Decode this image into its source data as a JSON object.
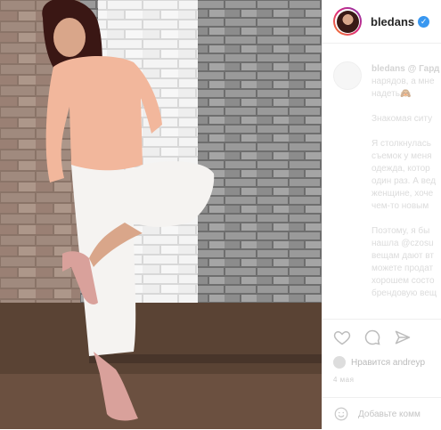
{
  "post": {
    "username": "bledans",
    "verified_mark": "✓"
  },
  "caption": {
    "lines": [
      "bledans @ Гард",
      "нарядов, а мне",
      "надеть🙈",
      "",
      "Знакомая ситу",
      "",
      "Я столкнулась",
      "съемок у меня",
      "одежда, котор",
      "один раз. А вед",
      "женщине, хоче",
      "чем-то новым",
      "",
      "Поэтому, я бы",
      "нашла @czosu",
      "вещам дают вт",
      "можете продат",
      "хорошем состо",
      "брендовую вещ"
    ]
  },
  "actions": {
    "like_icon": "heart-icon",
    "comment_icon": "comment-icon",
    "share_icon": "share-icon"
  },
  "likes_text": "Нравится andreyp",
  "date_text": "4 мая",
  "add_comment_placeholder": "Добавьте комм",
  "colors": {
    "brand_gradient": [
      "#f58529",
      "#dd2a7b",
      "#8134af"
    ],
    "verified": "#3897f0"
  }
}
